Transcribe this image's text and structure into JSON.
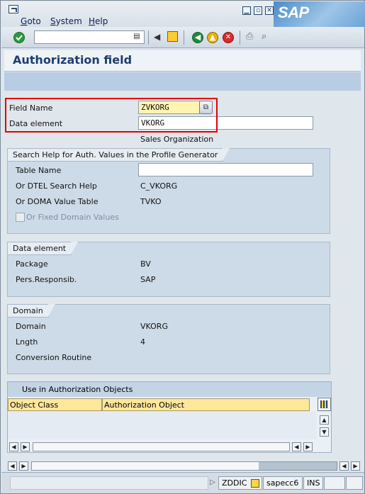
{
  "menu": {
    "items": [
      "Goto",
      "System",
      "Help"
    ],
    "underlined": [
      "G",
      "S",
      "H"
    ]
  },
  "window_controls": [
    "minimize-icon",
    "restore-icon",
    "close-icon"
  ],
  "brand": {
    "logo_text": "SAP"
  },
  "toolbar": {
    "icons": [
      "enter-icon",
      "command-field-dropdown-icon",
      "back-arrow-icon",
      "save-icon",
      "back-icon",
      "exit-icon",
      "cancel-icon",
      "print-icon",
      "find-icon"
    ]
  },
  "page": {
    "title": "Authorization field"
  },
  "fields": {
    "field_name": {
      "label": "Field Name",
      "value": "ZVKORG"
    },
    "data_element": {
      "label": "Data element",
      "value": "VKORG",
      "description": "Sales Organization"
    }
  },
  "search_help_group": {
    "title": "Search Help for Auth. Values in the Profile Generator",
    "rows": [
      {
        "label": "Table Name",
        "value": ""
      },
      {
        "label": "Or DTEL Search Help",
        "value": "C_VKORG"
      },
      {
        "label": "Or DOMA Value Table",
        "value": "TVKO"
      }
    ],
    "checkbox_label": "Or Fixed Domain Values"
  },
  "data_element_group": {
    "title": "Data element",
    "rows": [
      {
        "label": "Package",
        "value": "BV"
      },
      {
        "label": "Pers.Responsib.",
        "value": "SAP"
      }
    ]
  },
  "domain_group": {
    "title": "Domain",
    "rows": [
      {
        "label": "Domain",
        "value": "VKORG"
      },
      {
        "label": "Lngth",
        "value": "4"
      },
      {
        "label": "Conversion Routine",
        "value": ""
      }
    ]
  },
  "auth_objects_table": {
    "title": "Use in Authorization Objects",
    "columns": [
      "Object Class",
      "Authorization Object"
    ]
  },
  "status": {
    "system": "ZDDIC",
    "server": "sapecc6",
    "mode": "INS"
  },
  "colors": {
    "highlight": "#e60000",
    "required_field": "#fff4b2",
    "header_title": "#1e3e6e",
    "table_header": "#ffe79a"
  }
}
